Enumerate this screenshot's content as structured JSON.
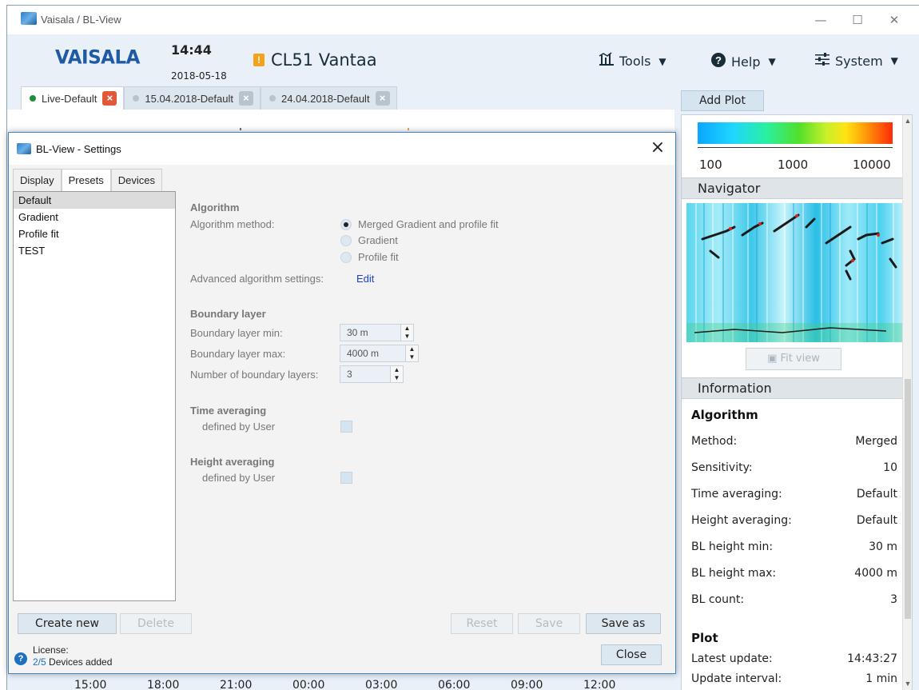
{
  "window": {
    "title": "Vaisala / BL-View",
    "minimize": "—",
    "maximize": "☐",
    "close": "✕"
  },
  "header": {
    "logo": "VAISALA",
    "time": "14:44",
    "date": "2018-05-18",
    "warning_icon": "!",
    "device": "CL51 Vantaa",
    "menus": {
      "tools": "Tools",
      "help": "Help",
      "system": "System"
    }
  },
  "tabs": [
    {
      "label": "Live-Default",
      "status_color": "#1e8e3e",
      "close_color": "#e05a3a"
    },
    {
      "label": "15.04.2018-Default",
      "status_color": "#b9c3cc",
      "close_color": "#b9c3cc"
    },
    {
      "label": "24.04.2018-Default",
      "status_color": "#b9c3cc",
      "close_color": "#b9c3cc"
    }
  ],
  "time_axis": [
    "15:00",
    "18:00",
    "21:00",
    "00:00",
    "03:00",
    "06:00",
    "09:00",
    "12:00"
  ],
  "right_panel": {
    "add_plot": "Add Plot",
    "colorbar_labels": [
      "100",
      "1000",
      "10000"
    ],
    "navigator_title": "Navigator",
    "fit_view": "Fit view",
    "information_title": "Information",
    "algorithm_title": "Algorithm",
    "rows": [
      {
        "label": "Method:",
        "value": "Merged"
      },
      {
        "label": "Sensitivity:",
        "value": "10"
      },
      {
        "label": "Time averaging:",
        "value": "Default"
      },
      {
        "label": "Height averaging:",
        "value": "Default"
      },
      {
        "label": "BL height min:",
        "value": "30 m"
      },
      {
        "label": "BL height max:",
        "value": "4000 m"
      },
      {
        "label": "BL count:",
        "value": "3"
      }
    ],
    "plot_title": "Plot",
    "plot_rows": [
      {
        "label": "Latest update:",
        "value": "14:43:27"
      },
      {
        "label": "Update interval:",
        "value": "1 min"
      }
    ]
  },
  "dialog": {
    "title": "BL-View - Settings",
    "tabs": [
      "Display",
      "Presets",
      "Devices"
    ],
    "selected_tab": "Presets",
    "presets": [
      "Default",
      "Gradient",
      "Profile fit",
      "TEST"
    ],
    "selected_preset": "Default",
    "algorithm": {
      "head": "Algorithm",
      "method_label": "Algorithm method:",
      "options": [
        "Merged Gradient and profile fit",
        "Gradient",
        "Profile fit"
      ],
      "selected": "Merged Gradient and profile fit",
      "advanced_label": "Advanced algorithm settings:",
      "edit": "Edit"
    },
    "boundary": {
      "head": "Boundary layer",
      "min_label": "Boundary layer min:",
      "min_value": "30 m",
      "max_label": "Boundary layer max:",
      "max_value": "4000 m",
      "count_label": "Number of boundary layers:",
      "count_value": "3"
    },
    "time_avg": {
      "head": "Time averaging",
      "sub": "defined by User"
    },
    "height_avg": {
      "head": "Height averaging",
      "sub": "defined by User"
    },
    "buttons": {
      "create_new": "Create new",
      "delete": "Delete",
      "reset": "Reset",
      "save": "Save",
      "save_as": "Save as",
      "close": "Close"
    },
    "license": {
      "label": "License:",
      "count": "2/5",
      "suffix": " Devices added"
    }
  }
}
